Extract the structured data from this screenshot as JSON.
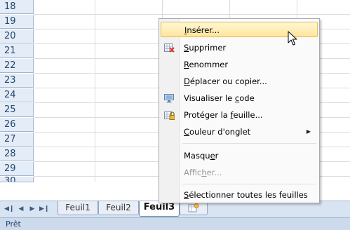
{
  "grid": {
    "rows": [
      "18",
      "19",
      "20",
      "21",
      "22",
      "23",
      "24",
      "25",
      "26",
      "27",
      "28",
      "29",
      "30"
    ]
  },
  "sheet_tabs": {
    "tabs": [
      {
        "label": "Feuil1"
      },
      {
        "label": "Feuil2"
      },
      {
        "label": "Feuil3"
      }
    ]
  },
  "status_bar": {
    "text": "Prêt"
  },
  "context_menu": {
    "items": [
      {
        "pre": "",
        "accel": "I",
        "post": "nsérer...",
        "state": "hover"
      },
      {
        "pre": "",
        "accel": "S",
        "post": "upprimer",
        "icon": "delete-sheet-icon"
      },
      {
        "pre": "",
        "accel": "R",
        "post": "enommer"
      },
      {
        "pre": "",
        "accel": "D",
        "post": "éplacer ou copier..."
      },
      {
        "pre": "Visualiser le ",
        "accel": "c",
        "post": "ode",
        "icon": "view-code-icon"
      },
      {
        "pre": "Protéger la ",
        "accel": "f",
        "post": "euille...",
        "icon": "protect-sheet-icon"
      },
      {
        "pre": "",
        "accel": "C",
        "post": "ouleur d'onglet",
        "has_submenu": true
      },
      {
        "pre": "Masqu",
        "accel": "e",
        "post": "r"
      },
      {
        "pre": "Affic",
        "accel": "h",
        "post": "er...",
        "state": "disabled"
      },
      {
        "pre": "",
        "accel": "S",
        "post": "électionner toutes les feuilles"
      }
    ]
  }
}
